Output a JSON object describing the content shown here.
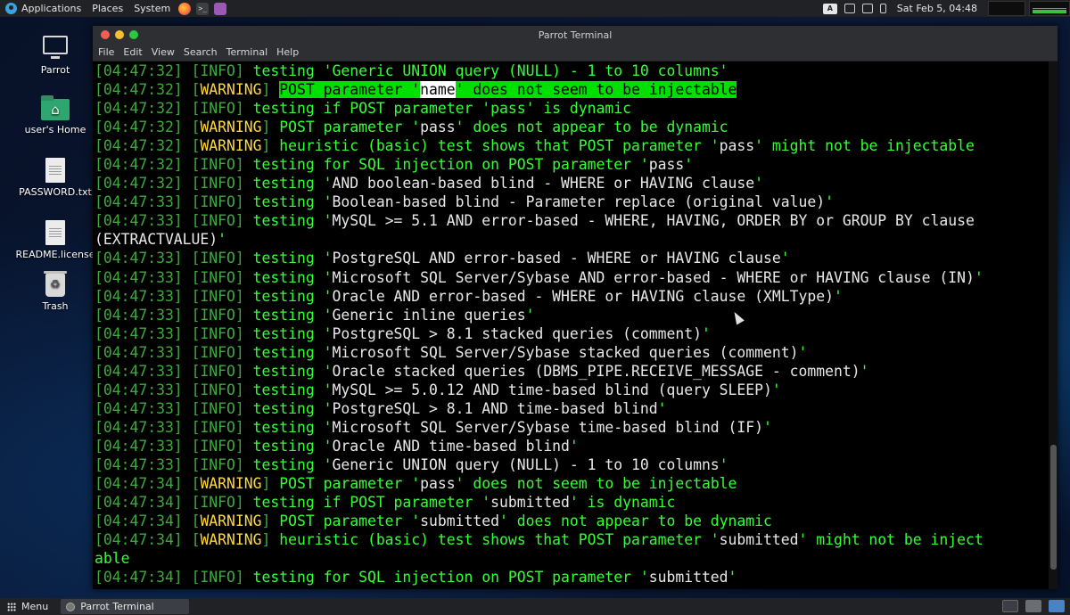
{
  "top_panel": {
    "applications": "Applications",
    "places": "Places",
    "system": "System",
    "launchers": [
      "firefox-icon",
      "terminal-icon",
      "notes-icon"
    ],
    "lang_indicator": "A",
    "clock": "Sat Feb 5, 04:48"
  },
  "desktop_icons": [
    {
      "label": "Parrot",
      "icon": "monitor-icon"
    },
    {
      "label": "user's Home",
      "icon": "home-folder-icon"
    },
    {
      "label": "PASSWORD.txt",
      "icon": "text-file-icon"
    },
    {
      "label": "README.license",
      "icon": "text-file-icon"
    },
    {
      "label": "Trash",
      "icon": "trash-icon"
    }
  ],
  "terminal": {
    "title": "Parrot Terminal",
    "menu": [
      "File",
      "Edit",
      "View",
      "Search",
      "Terminal",
      "Help"
    ],
    "lines": [
      {
        "ts": "04:47:32",
        "level": "INFO",
        "segments": [
          {
            "t": "testing 'Generic UNION query (NULL) - 1 to 10 columns'",
            "c": "msg"
          }
        ]
      },
      {
        "ts": "04:47:32",
        "level": "WARNING",
        "segments": [
          {
            "t": "POST parameter '",
            "c": "hl"
          },
          {
            "t": "name",
            "c": "hlname"
          },
          {
            "t": "' does not seem to be injectable",
            "c": "hl"
          }
        ]
      },
      {
        "ts": "04:47:32",
        "level": "INFO",
        "segments": [
          {
            "t": "testing if POST parameter 'pass' is dynamic",
            "c": "msg"
          }
        ]
      },
      {
        "ts": "04:47:32",
        "level": "WARNING",
        "segments": [
          {
            "t": "POST parameter '",
            "c": "msg"
          },
          {
            "t": "pass",
            "c": "wht"
          },
          {
            "t": "' does not appear to be dynamic",
            "c": "msg"
          }
        ]
      },
      {
        "ts": "04:47:32",
        "level": "WARNING",
        "segments": [
          {
            "t": "heuristic (basic) test shows that POST parameter '",
            "c": "msg"
          },
          {
            "t": "pass",
            "c": "wht"
          },
          {
            "t": "' might not be injectable",
            "c": "msg"
          }
        ]
      },
      {
        "ts": "04:47:32",
        "level": "INFO",
        "segments": [
          {
            "t": "testing for SQL injection on POST parameter '",
            "c": "msg"
          },
          {
            "t": "pass",
            "c": "wht"
          },
          {
            "t": "'",
            "c": "msg"
          }
        ]
      },
      {
        "ts": "04:47:32",
        "level": "INFO",
        "segments": [
          {
            "t": "testing '",
            "c": "msg"
          },
          {
            "t": "AND boolean-based blind - WHERE or HAVING clause",
            "c": "wht"
          },
          {
            "t": "'",
            "c": "msg"
          }
        ]
      },
      {
        "ts": "04:47:33",
        "level": "INFO",
        "segments": [
          {
            "t": "testing '",
            "c": "msg"
          },
          {
            "t": "Boolean-based blind - Parameter replace (original value)",
            "c": "wht"
          },
          {
            "t": "'",
            "c": "msg"
          }
        ]
      },
      {
        "ts": "04:47:33",
        "level": "INFO",
        "segments": [
          {
            "t": "testing '",
            "c": "msg"
          },
          {
            "t": "MySQL >= 5.1 AND error-based - WHERE, HAVING, ORDER BY or GROUP BY clause",
            "c": "wht"
          }
        ]
      },
      {
        "ts": "",
        "level": "",
        "segments": [
          {
            "t": "(EXTRACTVALUE)",
            "c": "wht"
          },
          {
            "t": "'",
            "c": "msg"
          }
        ]
      },
      {
        "ts": "04:47:33",
        "level": "INFO",
        "segments": [
          {
            "t": "testing '",
            "c": "msg"
          },
          {
            "t": "PostgreSQL AND error-based - WHERE or HAVING clause",
            "c": "wht"
          },
          {
            "t": "'",
            "c": "msg"
          }
        ]
      },
      {
        "ts": "04:47:33",
        "level": "INFO",
        "segments": [
          {
            "t": "testing '",
            "c": "msg"
          },
          {
            "t": "Microsoft SQL Server/Sybase AND error-based - WHERE or HAVING clause (IN)",
            "c": "wht"
          },
          {
            "t": "'",
            "c": "msg"
          }
        ]
      },
      {
        "ts": "04:47:33",
        "level": "INFO",
        "segments": [
          {
            "t": "testing '",
            "c": "msg"
          },
          {
            "t": "Oracle AND error-based - WHERE or HAVING clause (XMLType)",
            "c": "wht"
          },
          {
            "t": "'",
            "c": "msg"
          }
        ]
      },
      {
        "ts": "04:47:33",
        "level": "INFO",
        "segments": [
          {
            "t": "testing '",
            "c": "msg"
          },
          {
            "t": "Generic inline queries",
            "c": "wht"
          },
          {
            "t": "'",
            "c": "msg"
          }
        ]
      },
      {
        "ts": "04:47:33",
        "level": "INFO",
        "segments": [
          {
            "t": "testing '",
            "c": "msg"
          },
          {
            "t": "PostgreSQL > 8.1 stacked queries (comment)",
            "c": "wht"
          },
          {
            "t": "'",
            "c": "msg"
          }
        ]
      },
      {
        "ts": "04:47:33",
        "level": "INFO",
        "segments": [
          {
            "t": "testing '",
            "c": "msg"
          },
          {
            "t": "Microsoft SQL Server/Sybase stacked queries (comment)",
            "c": "wht"
          },
          {
            "t": "'",
            "c": "msg"
          }
        ]
      },
      {
        "ts": "04:47:33",
        "level": "INFO",
        "segments": [
          {
            "t": "testing '",
            "c": "msg"
          },
          {
            "t": "Oracle stacked queries (DBMS_PIPE.RECEIVE_MESSAGE - comment)",
            "c": "wht"
          },
          {
            "t": "'",
            "c": "msg"
          }
        ]
      },
      {
        "ts": "04:47:33",
        "level": "INFO",
        "segments": [
          {
            "t": "testing '",
            "c": "msg"
          },
          {
            "t": "MySQL >= 5.0.12 AND time-based blind (query SLEEP)",
            "c": "wht"
          },
          {
            "t": "'",
            "c": "msg"
          }
        ]
      },
      {
        "ts": "04:47:33",
        "level": "INFO",
        "segments": [
          {
            "t": "testing '",
            "c": "msg"
          },
          {
            "t": "PostgreSQL > 8.1 AND time-based blind",
            "c": "wht"
          },
          {
            "t": "'",
            "c": "msg"
          }
        ]
      },
      {
        "ts": "04:47:33",
        "level": "INFO",
        "segments": [
          {
            "t": "testing '",
            "c": "msg"
          },
          {
            "t": "Microsoft SQL Server/Sybase time-based blind (IF)",
            "c": "wht"
          },
          {
            "t": "'",
            "c": "msg"
          }
        ]
      },
      {
        "ts": "04:47:33",
        "level": "INFO",
        "segments": [
          {
            "t": "testing '",
            "c": "msg"
          },
          {
            "t": "Oracle AND time-based blind",
            "c": "wht"
          },
          {
            "t": "'",
            "c": "msg"
          }
        ]
      },
      {
        "ts": "04:47:33",
        "level": "INFO",
        "segments": [
          {
            "t": "testing '",
            "c": "msg"
          },
          {
            "t": "Generic UNION query (NULL) - 1 to 10 columns",
            "c": "wht"
          },
          {
            "t": "'",
            "c": "msg"
          }
        ]
      },
      {
        "ts": "04:47:34",
        "level": "WARNING",
        "segments": [
          {
            "t": "POST parameter '",
            "c": "msg"
          },
          {
            "t": "pass",
            "c": "wht"
          },
          {
            "t": "' does not seem to be injectable",
            "c": "msg"
          }
        ]
      },
      {
        "ts": "04:47:34",
        "level": "INFO",
        "segments": [
          {
            "t": "testing if POST parameter '",
            "c": "msg"
          },
          {
            "t": "submitted",
            "c": "wht"
          },
          {
            "t": "' is dynamic",
            "c": "msg"
          }
        ]
      },
      {
        "ts": "04:47:34",
        "level": "WARNING",
        "segments": [
          {
            "t": "POST parameter '",
            "c": "msg"
          },
          {
            "t": "submitted",
            "c": "wht"
          },
          {
            "t": "' does not appear to be dynamic",
            "c": "msg"
          }
        ]
      },
      {
        "ts": "04:47:34",
        "level": "WARNING",
        "segments": [
          {
            "t": "heuristic (basic) test shows that POST parameter '",
            "c": "msg"
          },
          {
            "t": "submitted",
            "c": "wht"
          },
          {
            "t": "' might not be inject",
            "c": "msg"
          }
        ]
      },
      {
        "ts": "",
        "level": "",
        "segments": [
          {
            "t": "able",
            "c": "msg"
          }
        ]
      },
      {
        "ts": "04:47:34",
        "level": "INFO",
        "segments": [
          {
            "t": "testing for SQL injection on POST parameter '",
            "c": "msg"
          },
          {
            "t": "submitted",
            "c": "wht"
          },
          {
            "t": "'",
            "c": "msg"
          }
        ]
      }
    ]
  },
  "bottom_panel": {
    "menu": "Menu",
    "tasks": [
      {
        "label": "Parrot Terminal"
      }
    ]
  }
}
